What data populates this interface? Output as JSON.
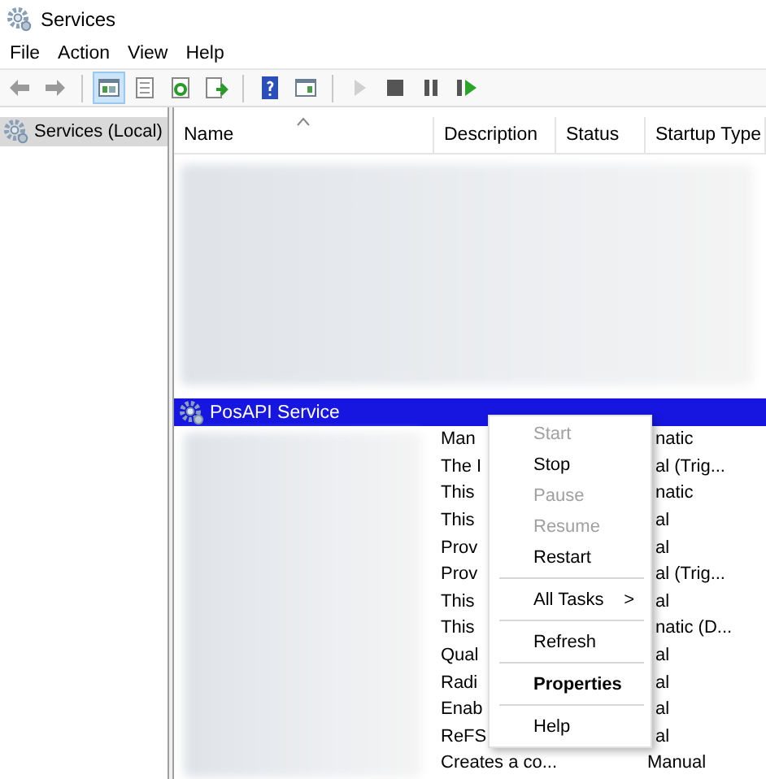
{
  "window": {
    "title": "Services"
  },
  "menu_bar": [
    {
      "label": "File"
    },
    {
      "label": "Action"
    },
    {
      "label": "View"
    },
    {
      "label": "Help"
    }
  ],
  "toolbar": [
    {
      "pressed": false,
      "disabled": false
    },
    {
      "pressed": false,
      "disabled": false
    },
    {
      "pressed": true,
      "disabled": false
    },
    {
      "pressed": false,
      "disabled": false
    },
    {
      "pressed": false,
      "disabled": false
    },
    {
      "pressed": false,
      "disabled": false
    },
    {
      "pressed": false,
      "disabled": false
    },
    {
      "pressed": false,
      "disabled": false
    },
    {
      "pressed": false,
      "disabled": true
    },
    {
      "pressed": false,
      "disabled": false
    },
    {
      "pressed": false,
      "disabled": false
    },
    {
      "pressed": false,
      "disabled": false
    }
  ],
  "tree": [
    {
      "label": "Services (Local)",
      "selected": true
    }
  ],
  "table": {
    "columns": [
      "Name",
      "Description",
      "Status",
      "Startup Type"
    ],
    "selected_row": {
      "name": "PosAPI Service",
      "selected": true
    },
    "rows_behind_menu": [
      {
        "description": "Man",
        "startup_type": "natic"
      },
      {
        "description": "The I",
        "startup_type": "al (Trig..."
      },
      {
        "description": "This",
        "startup_type": "natic"
      },
      {
        "description": "This",
        "startup_type": "al"
      },
      {
        "description": "Prov",
        "startup_type": "al"
      },
      {
        "description": "Prov",
        "startup_type": "al (Trig..."
      },
      {
        "description": "This",
        "startup_type": "al"
      },
      {
        "description": "This",
        "startup_type": "natic (D..."
      },
      {
        "description": "Qual",
        "startup_type": "al"
      },
      {
        "description": "Radi",
        "startup_type": "al"
      },
      {
        "description": "Enab",
        "startup_type": "al"
      },
      {
        "description": "ReFS",
        "startup_type": "al"
      }
    ],
    "last_row": {
      "description": "Creates a co...",
      "startup_type": "Manual"
    }
  },
  "context_menu": [
    {
      "kind": "item",
      "label": "Start",
      "disabled": true
    },
    {
      "kind": "item",
      "label": "Stop",
      "disabled": false
    },
    {
      "kind": "item",
      "label": "Pause",
      "disabled": true
    },
    {
      "kind": "item",
      "label": "Resume",
      "disabled": true
    },
    {
      "kind": "item",
      "label": "Restart",
      "disabled": false
    },
    {
      "kind": "separator"
    },
    {
      "kind": "submenu",
      "label": "All Tasks",
      "arrow": ">",
      "disabled": false
    },
    {
      "kind": "separator"
    },
    {
      "kind": "item",
      "label": "Refresh",
      "disabled": false
    },
    {
      "kind": "separator"
    },
    {
      "kind": "default",
      "label": "Properties",
      "disabled": false
    },
    {
      "kind": "separator"
    },
    {
      "kind": "item",
      "label": "Help",
      "disabled": false
    }
  ]
}
